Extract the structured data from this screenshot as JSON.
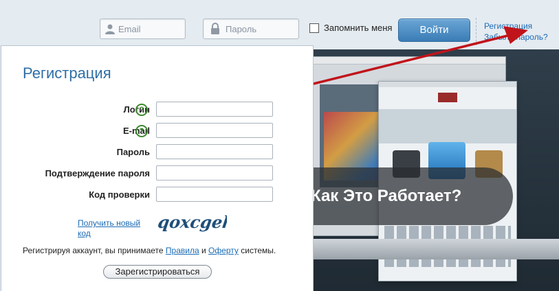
{
  "header": {
    "email_placeholder": "Email",
    "password_placeholder": "Пароль",
    "remember_label": "Запомнить меня",
    "login_button": "Войти",
    "register_link": "Регистрация",
    "forgot_link": "Забыли пароль?"
  },
  "promo": {
    "banner_text": "Как Это Работает?"
  },
  "registration": {
    "title": "Регистрация",
    "fields": [
      {
        "label": "Логин",
        "help": "?"
      },
      {
        "label": "E-mail",
        "help": "?"
      },
      {
        "label": "Пароль"
      },
      {
        "label": "Подтверждение пароля"
      },
      {
        "label": "Код проверки"
      }
    ],
    "new_code_link": "Получить новый код",
    "captcha_text": "qoxcgeh",
    "terms_prefix": "Регистрируя аккаунт, вы принимаете ",
    "terms_rules": "Правила",
    "terms_and": " и ",
    "terms_offer": "Оферту",
    "terms_suffix": " системы.",
    "submit_button": "Зарегистрироваться"
  },
  "colors": {
    "accent": "#2e6ea7",
    "link": "#1c6bb4",
    "arrow": "#c0141a",
    "help": "#3d8a2f"
  }
}
